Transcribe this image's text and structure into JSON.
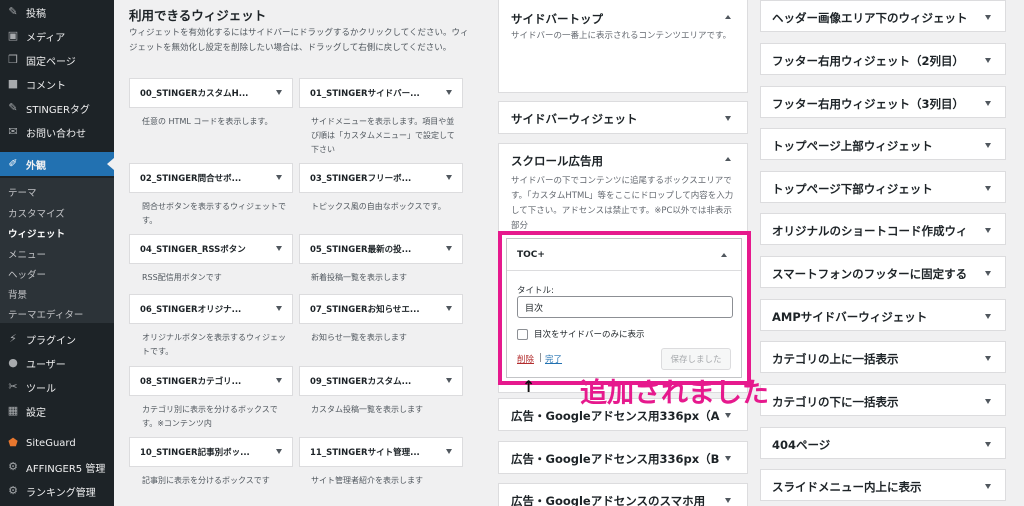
{
  "admin_menu": {
    "items": [
      {
        "label": "投稿",
        "icon": "pin-icon"
      },
      {
        "label": "メディア",
        "icon": "media-icon"
      },
      {
        "label": "固定ページ",
        "icon": "page-icon"
      },
      {
        "label": "コメント",
        "icon": "comment-icon"
      },
      {
        "label": "STINGERタグ",
        "icon": "pin-icon"
      },
      {
        "label": "お問い合わせ",
        "icon": "mail-icon"
      },
      {
        "label": "外観",
        "icon": "brush-icon"
      },
      {
        "label": "プラグイン",
        "icon": "plugin-icon"
      },
      {
        "label": "ユーザー",
        "icon": "user-icon"
      },
      {
        "label": "ツール",
        "icon": "wrench-icon"
      },
      {
        "label": "設定",
        "icon": "settings-icon"
      },
      {
        "label": "SiteGuard",
        "icon": "shield-icon"
      },
      {
        "label": "AFFINGER5 管理",
        "icon": "gear-icon"
      },
      {
        "label": "ランキング管理",
        "icon": "gear-icon"
      }
    ],
    "submenu": [
      "テーマ",
      "カスタマイズ",
      "ウィジェット",
      "メニュー",
      "ヘッダー",
      "背景",
      "テーマエディター"
    ]
  },
  "available": {
    "title": "利用できるウィジェット",
    "description": "ウィジェットを有効化するにはサイドバーにドラッグするかクリックしてください。ウィジェットを無効化し設定を削除したい場合は、ドラッグして右側に戻してください。",
    "widgets": [
      {
        "title": "00_STINGERカスタムH...",
        "desc": "任意の HTML コードを表示します。"
      },
      {
        "title": "01_STINGERサイドバー...",
        "desc": "サイドメニューを表示します。項目や並び順は「カスタムメニュー」で設定して下さい"
      },
      {
        "title": "02_STINGER問合せボ...",
        "desc": "問合せボタンを表示するウィジェットです。"
      },
      {
        "title": "03_STINGERフリーボ...",
        "desc": "トピックス風の自由なボックスです。"
      },
      {
        "title": "04_STINGER_RSSボタン",
        "desc": "RSS配信用ボタンです"
      },
      {
        "title": "05_STINGER最新の投...",
        "desc": "新着投稿一覧を表示します"
      },
      {
        "title": "06_STINGERオリジナ...",
        "desc": "オリジナルボタンを表示するウィジェットです。"
      },
      {
        "title": "07_STINGERお知らせエ...",
        "desc": "お知らせ一覧を表示します"
      },
      {
        "title": "08_STINGERカテゴリ...",
        "desc": "カテゴリ別に表示を分けるボックスです。※コンテンツ内"
      },
      {
        "title": "09_STINGERカスタム...",
        "desc": "カスタム投稿一覧を表示します"
      },
      {
        "title": "10_STINGER記事別ボッ...",
        "desc": "記事別に表示を分けるボックスです"
      },
      {
        "title": "11_STINGERサイト管理...",
        "desc": "サイト管理者紹介を表示します"
      }
    ]
  },
  "areas": {
    "top": {
      "title": "サイドバートップ",
      "desc": "サイドバーの一番上に表示されるコンテンツエリアです。"
    },
    "sidebar": {
      "title": "サイドバーウィジェット"
    },
    "scroll": {
      "title": "スクロール広告用",
      "desc": "サイドバーの下でコンテンツに追尾するボックスエリアです。「カスタムHTML」等をここにドロップして内容を入力して下さい。アドセンスは禁止です。※PC以外では非表示部分"
    },
    "ad1": {
      "title": "広告・Googleアドセンス用336px（A"
    },
    "ad2": {
      "title": "広告・Googleアドセンス用336px（B"
    },
    "ad3": {
      "title": "広告・Googleアドセンスのスマホ用"
    }
  },
  "toc_widget": {
    "name": "TOC+",
    "title_label": "タイトル:",
    "title_value": "目次",
    "checkbox_label": "目次をサイドバーのみに表示",
    "delete_label": "削除",
    "separator": "|",
    "done_label": "完了",
    "save_label": "保存しました"
  },
  "annotation": {
    "arrow": "↑",
    "text": "追加されました"
  },
  "right_areas": [
    "ヘッダー画像エリア下のウィジェット",
    "フッター右用ウィジェット（2列目）",
    "フッター右用ウィジェット（3列目）",
    "トップページ上部ウィジェット",
    "トップページ下部ウィジェット",
    "オリジナルのショートコード作成ウィ",
    "スマートフォンのフッターに固定する",
    "AMPサイドバーウィジェット",
    "カテゴリの上に一括表示",
    "カテゴリの下に一括表示",
    "404ページ",
    "スライドメニュー内上に表示"
  ]
}
